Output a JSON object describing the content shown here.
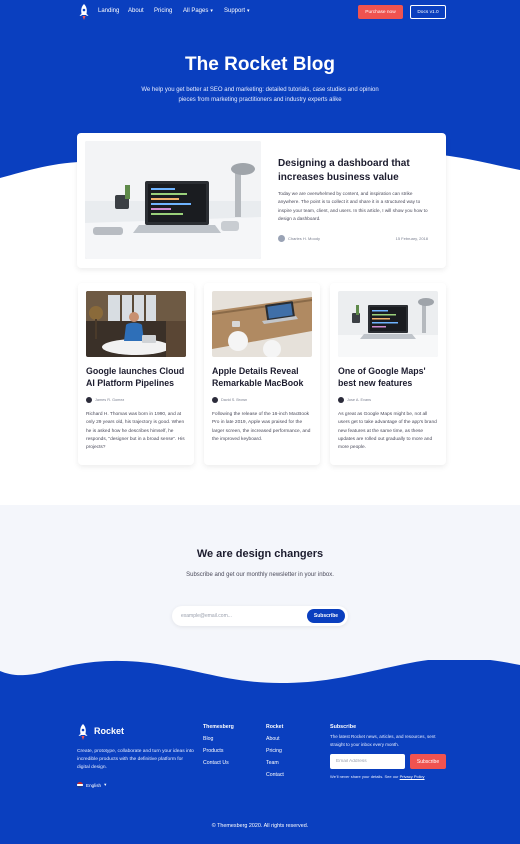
{
  "nav": {
    "links": [
      "Landing",
      "About",
      "Pricing",
      "All Pages",
      "Support"
    ],
    "purchase_label": "Purchase now",
    "docs_label": "Docs v1.0"
  },
  "hero": {
    "title": "The Rocket Blog",
    "subtitle": "We help you get better at SEO and marketing: detailed tutorials, case studies and opinion pieces from marketing practitioners and industry experts alike"
  },
  "featured": {
    "title": "Designing a dashboard that increases business value",
    "excerpt": "Today we are overwhelmed by content, and inspiration can strike anywhere. The point is to collect it and share it in a structured way to inspire your team, client, and users. In this article, I will show you how to design a dashboard.",
    "author": "Charles H. Moody",
    "date": "15 February, 2018"
  },
  "cards": [
    {
      "title": "Google launches Cloud AI Platform Pipelines",
      "author": "James R. Gomez",
      "excerpt": "Richard H. Thomas was born in 1990, and at only 29 years old, his trajectory is good. When he is asked how he describes himself, he responds, \"designer but in a broad sense\". His projects?"
    },
    {
      "title": "Apple Details Reveal Remarkable MacBook",
      "author": "David S. Brown",
      "excerpt": "Following the release of the 16-inch MacBook Pro in late 2019, Apple was praised for the larger screen, the increased performance, and the improved keyboard."
    },
    {
      "title": "One of Google Maps' best new features",
      "author": "Jose A. Evans",
      "excerpt": "As great as Google Maps might be, not all users get to take advantage of the app's brand new features at the same time, as these updates are rolled out gradually to more and more people."
    }
  ],
  "newsletter": {
    "title": "We are design changers",
    "subtitle": "Subscribe and get our monthly newsletter in your inbox.",
    "placeholder": "example@email.com...",
    "button_label": "Subscribe"
  },
  "footer": {
    "brand": "Rocket",
    "description": "Create, prototype, collaborate and turn your ideas into incredible products with the definitive platform for digital design.",
    "language": "English",
    "col1": {
      "head": "Themesberg",
      "links": [
        "Blog",
        "Products",
        "Contact Us"
      ]
    },
    "col2": {
      "head": "Rocket",
      "links": [
        "About",
        "Pricing",
        "Team",
        "Contact"
      ]
    },
    "subscribe": {
      "head": "Subscribe",
      "text": "The latest Rocket news, articles, and resources, sent straight to your inbox every month.",
      "placeholder": "Email Address",
      "button_label": "Subscribe",
      "note": "We'll never share your details. See our",
      "note_link": "Privacy Policy"
    },
    "copyright": "© Themesberg 2020. All rights reserved."
  },
  "colors": {
    "brand_blue": "#0a3fbf",
    "accent_red": "#ef5350"
  },
  "icons": [
    "rocket-logo-icon",
    "chevron-down-icon",
    "us-flag-icon"
  ]
}
